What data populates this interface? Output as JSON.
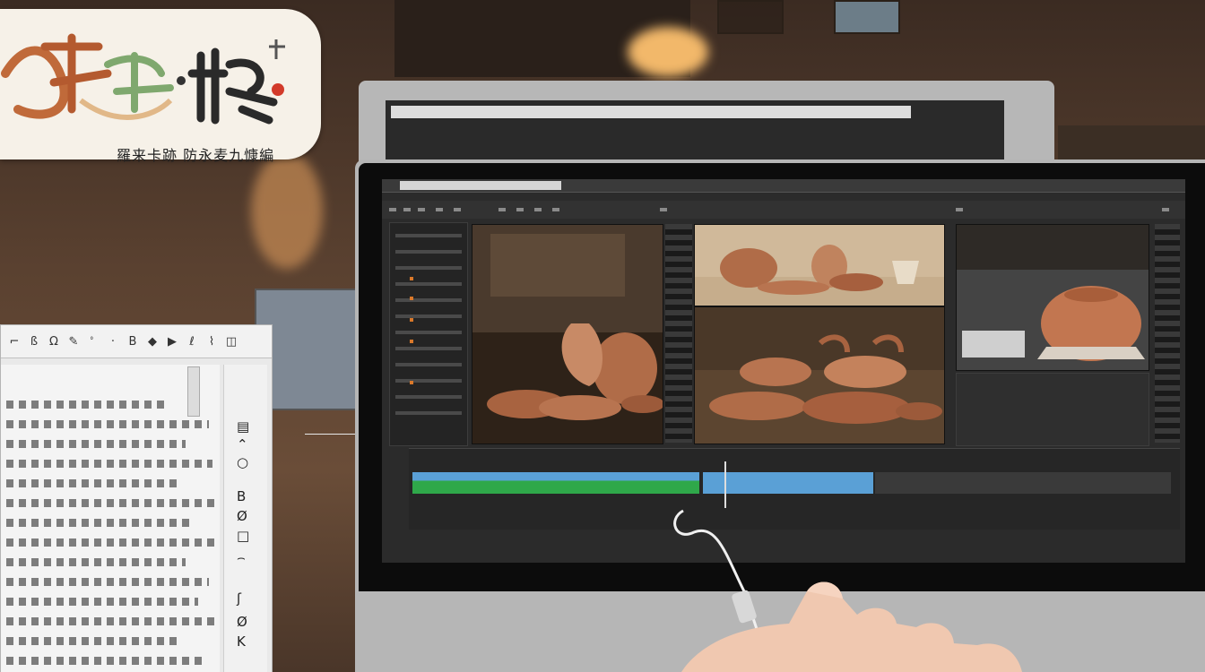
{
  "logo": {
    "caption": "羅来卡跡 防永麦九慷編"
  },
  "doc_window": {
    "toolbar_glyphs": [
      "⌐",
      "ß",
      "Ω",
      "✎",
      "ﾟ",
      "·",
      "B",
      "◆",
      "▶",
      "ℓ",
      "⌇",
      "◫"
    ],
    "side_glyphs": [
      "▤",
      "⌃",
      "○",
      "B",
      "Ø",
      "□",
      "⌢",
      "ʃ",
      "Ø",
      "K"
    ]
  },
  "editor": {
    "colors": {
      "clay": "#b5704a",
      "clay_light": "#d39a74",
      "panel": "#242424",
      "audio_green": "#2fa84a",
      "audio_blue": "#5aa0d6"
    }
  }
}
